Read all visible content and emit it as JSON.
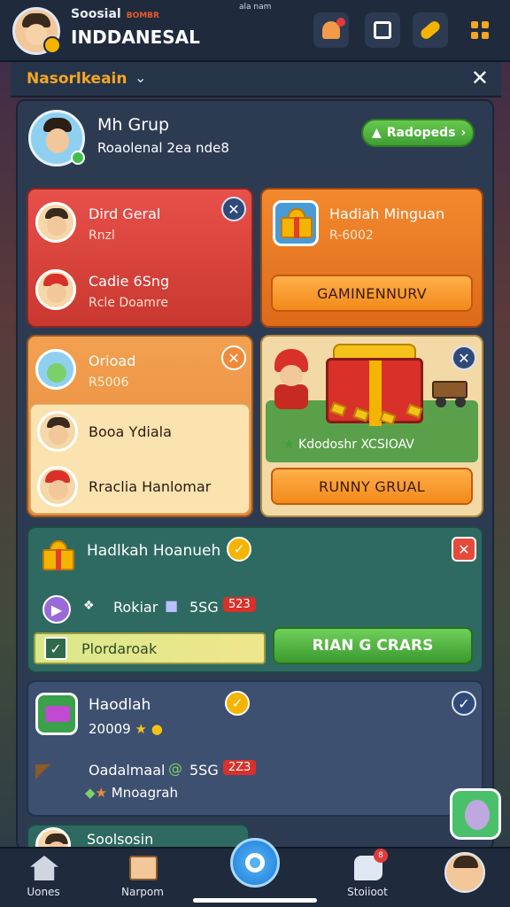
{
  "header": {
    "app_subtitle": "Soosial",
    "app_subtitle_accent": "BOMBR",
    "app_title": "INDDANESAL",
    "tiny_note": "ala nam"
  },
  "dropdown": {
    "label": "Nasorlkeain"
  },
  "group": {
    "title": "Mh Grup",
    "subtitle": "Roaolenal 2ea nde8",
    "button_label": "Radopeds"
  },
  "cards": {
    "red": {
      "item1_title": "Dird Geral",
      "item1_sub": "Rnzl",
      "item2_title": "Cadie 6Sng",
      "item2_sub": "Rcle Doamre"
    },
    "orange": {
      "title": "Hadiah Minguan",
      "sub": "R-6002",
      "button": "GAMINENNURV"
    },
    "amber": {
      "title": "Orioad",
      "sub": "R5006",
      "row1": "Booa Ydiala",
      "row2": "Rraclia Hanlomar"
    },
    "yellow": {
      "caption": "Kdodoshr XCSIOAV",
      "button": "RUNNY GRUAL"
    },
    "teal": {
      "title": "Hadlkah Hoanueh",
      "row_label": "Rokiar",
      "row_value": "5SG",
      "row_badge": "523",
      "bar_label": "Plordaroak",
      "button": "RIAN G CRARS"
    },
    "slate": {
      "title": "Haodlah",
      "value": "20009",
      "row_label": "Oadalmaal",
      "row_value": "5SG",
      "row_badge": "2Z3",
      "sub_label": "Mnoagrah"
    },
    "bottom": {
      "title": "Soolsosin"
    }
  },
  "nav": {
    "home": "Uones",
    "notes": "Narpom",
    "chat": "Stoiioot",
    "chat_badge": "8"
  }
}
